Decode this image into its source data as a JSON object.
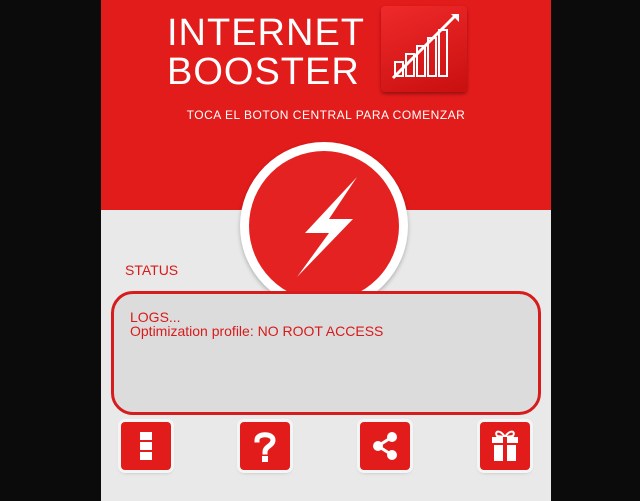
{
  "header": {
    "title_line1": "INTERNET",
    "title_line2": "BOOSTER",
    "subtitle": "TOCA EL BOTON CENTRAL PARA COMENZAR",
    "logo_icon": "signal-bars-boost-icon"
  },
  "main_button": {
    "icon": "lightning-bolt-icon"
  },
  "status": {
    "label": "STATUS",
    "logs_title": "LOGS...",
    "logs_line": "Optimization profile: NO ROOT ACCESS"
  },
  "bottom_buttons": [
    {
      "icon": "menu-icon"
    },
    {
      "icon": "help-question-icon"
    },
    {
      "icon": "share-icon"
    },
    {
      "icon": "gift-icon"
    }
  ],
  "colors": {
    "primary_red": "#e21b1b",
    "background": "#e9e9e9",
    "text_on_red": "#ffffff"
  }
}
